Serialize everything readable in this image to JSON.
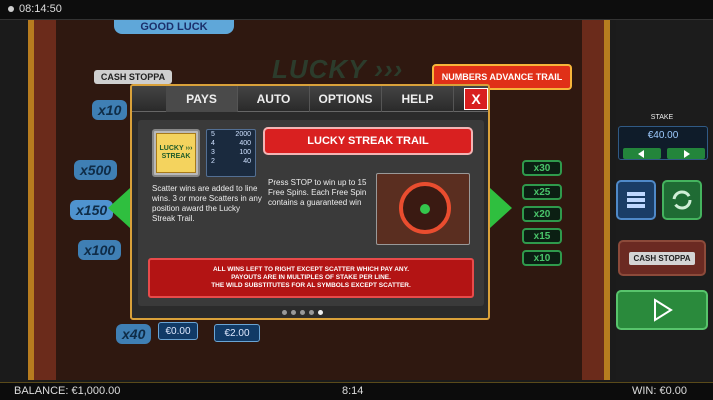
{
  "status": {
    "time": "08:14:50"
  },
  "game": {
    "good_luck": "GOOD LUCK",
    "logo": "LUCKY ›››",
    "numbers_trail": "NUMBERS ADVANCE TRAIL",
    "cash_stoppa": "CASH STOPPA",
    "left_ladder": [
      "x10",
      "x500",
      "x150",
      "x100",
      "x40"
    ],
    "right_ladder": [
      "x30",
      "x25",
      "x20",
      "x15",
      "x10"
    ],
    "bottom_values": [
      "€0.00",
      "€2.00"
    ]
  },
  "side": {
    "stake_label": "STAKE",
    "stake_value": "€40.00",
    "cashstoppa_label": "CASH STOPPA"
  },
  "dialog": {
    "tabs": [
      "PAYS",
      "AUTO",
      "OPTIONS",
      "HELP"
    ],
    "active_tab": "PAYS",
    "close": "X",
    "symbol_label": "LUCKY ››› STREAK",
    "paytable": [
      {
        "count": "5",
        "pay": "2000"
      },
      {
        "count": "4",
        "pay": "400"
      },
      {
        "count": "3",
        "pay": "100"
      },
      {
        "count": "2",
        "pay": "40"
      }
    ],
    "scatter_text": "Scatter wins are added to line wins. 3 or more Scatters in any position award the Lucky Streak Trail.",
    "trail_title": "LUCKY STREAK TRAIL",
    "trail_text": "Press STOP to win up to 15 Free Spins. Each Free Spin contains a guaranteed win",
    "banner_1": "ALL WINS LEFT TO RIGHT EXCEPT SCATTER WHICH PAY ANY.",
    "banner_2": "PAYOUTS ARE IN MULTIPLES OF STAKE PER LINE.",
    "banner_3": "THE WILD SUBSTITUTES FOR AL SYMBOLS EXCEPT SCATTER."
  },
  "bottom": {
    "balance": "BALANCE: €1,000.00",
    "time": "8:14",
    "win": "WIN: €0.00"
  }
}
